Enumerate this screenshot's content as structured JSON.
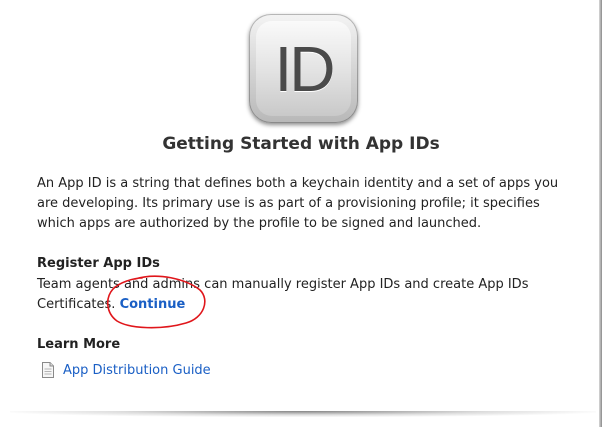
{
  "icon": {
    "label": "ID"
  },
  "page": {
    "title": "Getting Started with App IDs"
  },
  "intro": {
    "text": "An App ID is a string that defines both a keychain identity and a set of apps you are developing. Its primary use is as part of a provisioning profile; it specifies which apps are authorized by the profile to be signed and launched."
  },
  "register": {
    "title": "Register App IDs",
    "text": "Team agents and admins can manually register App IDs and create App IDs Certificates.",
    "link": "Continue"
  },
  "learn_more": {
    "title": "Learn More",
    "links": [
      {
        "label": "App Distribution Guide",
        "icon": "document-icon"
      }
    ]
  },
  "annotation": {
    "color": "#e0161b"
  },
  "colors": {
    "link": "#1a5fc5"
  }
}
